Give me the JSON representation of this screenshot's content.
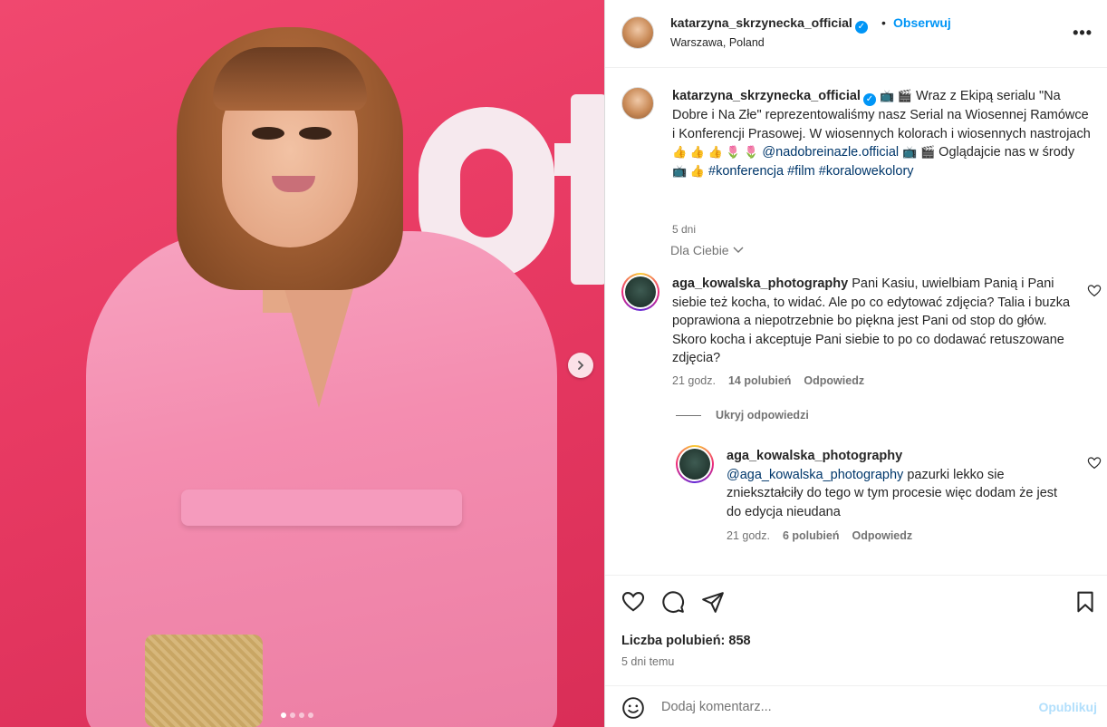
{
  "post": {
    "author": "katarzyna_skrzynecka_official",
    "follow_label": "Obserwuj",
    "separator": "•",
    "location": "Warszawa, Poland",
    "more_label": "•••"
  },
  "caption": {
    "author": "katarzyna_skrzynecka_official",
    "emoji_intro": "📺 🎬",
    "text_1": "Wraz z Ekipą serialu \"Na Dobre i Na Złe\" reprezentowaliśmy nasz Serial na Wiosennej Ramówce i Konferencji Prasowej. W wiosennych kolorach i wiosennych nastrojach",
    "emoji_mid": "👍 👍 👍 🌷 🌷",
    "mention": "@nadobreinazle.official",
    "emoji_2": "📺 🎬",
    "text_2": "Oglądajcie nas w środy",
    "emoji_3": "📺 👍",
    "hashtag_1": "#konferencja",
    "hashtag_2": "#film",
    "hashtag_3": "#koralowekolory",
    "age": "5 dni"
  },
  "for_you_label": "Dla Ciebie",
  "comments": [
    {
      "user": "aga_kowalska_photography",
      "text": "Pani Kasiu, uwielbiam Panią i Pani siebie też kocha, to widać. Ale po co edytować zdjęcia? Talia i buzka poprawiona a niepotrzebnie bo piękna jest Pani od stop do głów. Skoro kocha i akceptuje Pani siebie to po co dodawać retuszowane zdjęcia?",
      "age": "21 godz.",
      "likes": "14 polubień",
      "reply_label": "Odpowiedz"
    },
    {
      "user": "aga_kowalska_photography",
      "mention": "@aga_kowalska_photography",
      "text": "pazurki lekko sie zniekształciły do tego w tym procesie więc dodam że jest do edycja nieudana",
      "age": "21 godz.",
      "likes": "6 polubień",
      "reply_label": "Odpowiedz"
    }
  ],
  "hide_replies_label": "Ukryj odpowiedzi",
  "actions": {
    "likes_text": "Liczba polubień: 858",
    "posted_ago": "5 dni temu"
  },
  "comment_box": {
    "placeholder": "Dodaj komentarz...",
    "publish_label": "Opublikuj"
  },
  "carousel": {
    "total": 4,
    "active": 1
  },
  "colors": {
    "accent": "#0095f6",
    "link": "#00376b",
    "muted": "#737373",
    "photo_bg": "#e83a63"
  }
}
